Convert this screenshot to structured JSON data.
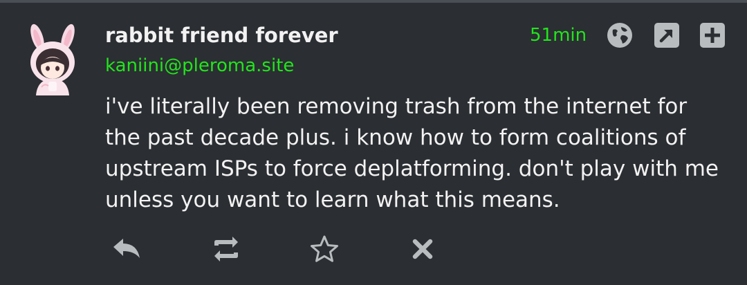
{
  "post": {
    "display_name": "rabbit friend forever",
    "handle": "kaniini@pleroma.site",
    "timestamp": "51min",
    "content": "i've literally been removing trash from the internet for the past decade plus. i know how to form coalitions of upstream ISPs to force deplatforming. don't play with me unless you want to learn what this means."
  },
  "header_icons": [
    "globe-icon",
    "external-link-icon",
    "plus-icon"
  ],
  "actions": [
    "reply-icon",
    "repeat-icon",
    "favorite-star-icon",
    "delete-icon"
  ],
  "colors": {
    "background": "#2b2e32",
    "text": "#f2f2f2",
    "accent": "#22e51d",
    "icon": "#b9bcbf"
  }
}
